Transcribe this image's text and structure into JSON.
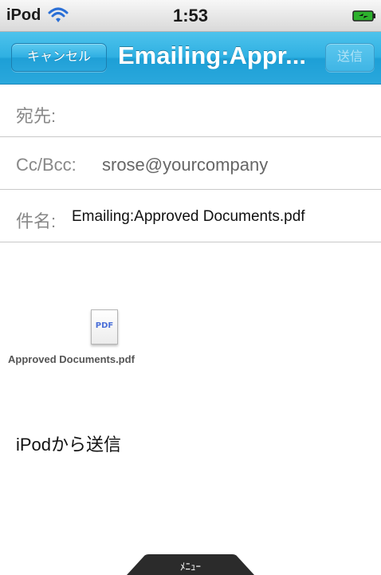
{
  "status_bar": {
    "device": "iPod",
    "time": "1:53",
    "wifi_icon": "wifi-icon",
    "battery_icon": "battery-charging-icon"
  },
  "nav_bar": {
    "cancel_label": "キャンセル",
    "title": "Emailing:Appr...",
    "send_label": "送信",
    "color": "#2aa8dc"
  },
  "fields": {
    "to_label": "宛先:",
    "to_value": "",
    "cc_label": "Cc/Bcc:",
    "cc_value": "srose@yourcompany",
    "subject_label": "件名:",
    "subject_value": "Emailing:Approved Documents.pdf"
  },
  "attachment": {
    "icon_text": "PDF",
    "icon": "pdf-file-icon",
    "name": "Approved Documents.pdf"
  },
  "body": {
    "signature": "iPodから送信"
  },
  "menu_tab": {
    "label": "ﾒﾆｭｰ"
  }
}
